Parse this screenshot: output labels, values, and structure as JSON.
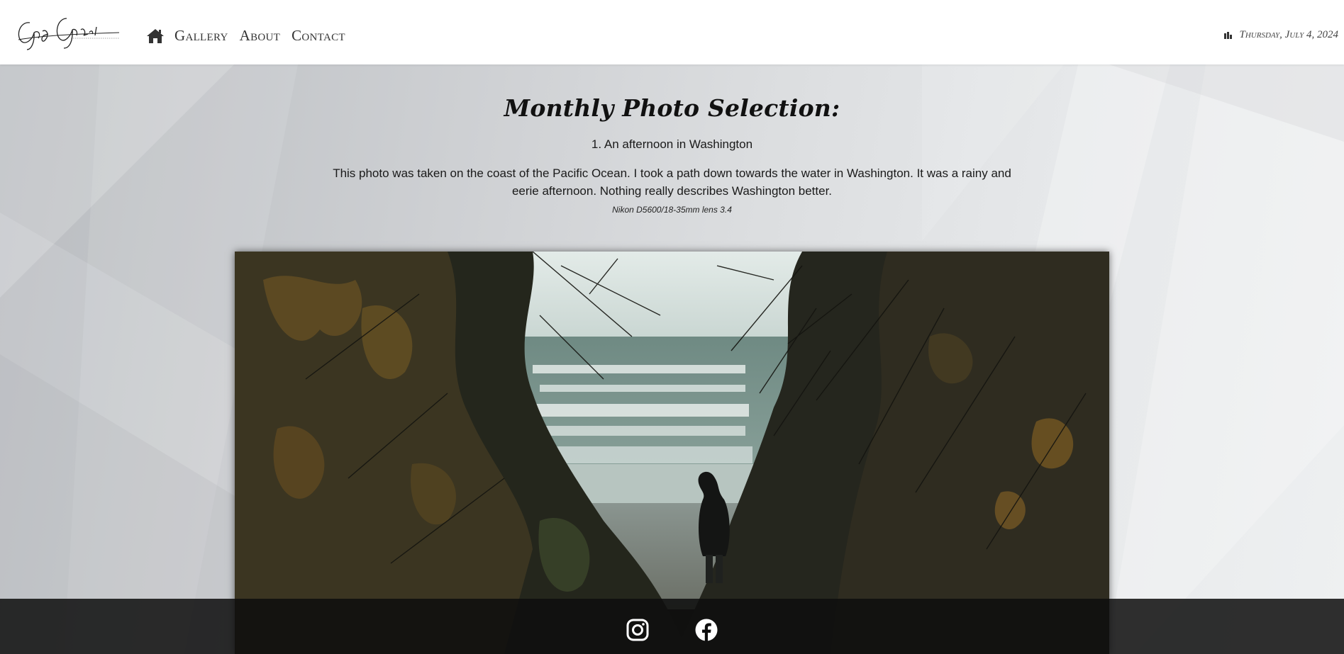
{
  "header": {
    "logo_alt": "Greg Grevé Photography",
    "nav": {
      "home_icon": "home-icon",
      "items": [
        {
          "label": "Gallery"
        },
        {
          "label": "About"
        },
        {
          "label": "Contact"
        }
      ]
    },
    "date_icon": "calendar-icon",
    "date": "Thursday, July 4, 2024"
  },
  "main": {
    "title": "Monthly Photo Selection:",
    "photo_number": "1. An afternoon in Washington",
    "description": "This photo was taken on the coast of the Pacific Ocean. I took a path down towards the water in Washington. It was a rainy and eerie afternoon. Nothing really describes Washington better.",
    "camera": "Nikon D5600/18-35mm lens 3.4"
  },
  "footer": {
    "social": [
      {
        "name": "instagram-icon"
      },
      {
        "name": "facebook-icon"
      }
    ]
  },
  "colors": {
    "header_bg": "#ffffff",
    "footer_bg": "#0e0e0e",
    "text": "#1a1a1a"
  }
}
